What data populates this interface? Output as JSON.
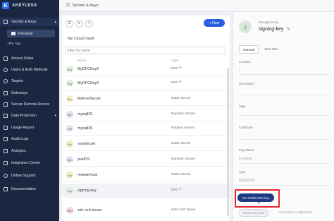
{
  "brand": {
    "logo_letter": "K",
    "name": "AKEYLESS"
  },
  "sidebar": {
    "items": [
      {
        "label": "Secrets & Keys",
        "icon": "key-icon"
      },
      {
        "label": "Access Roles",
        "icon": "roles-icon"
      },
      {
        "label": "Users & Auth Methods",
        "icon": "users-icon"
      },
      {
        "label": "Targets",
        "icon": "target-icon"
      },
      {
        "label": "Gateways",
        "icon": "gateway-icon"
      },
      {
        "label": "Secure Remote Access",
        "icon": "remote-icon"
      },
      {
        "label": "Data Protection",
        "icon": "shield-icon"
      },
      {
        "label": "Usage Report",
        "icon": "report-icon"
      },
      {
        "label": "Audit Logs",
        "icon": "log-icon"
      },
      {
        "label": "Analytics",
        "icon": "analytics-icon"
      },
      {
        "label": "Integration Center",
        "icon": "integration-icon"
      },
      {
        "label": "Online Support",
        "icon": "support-icon"
      },
      {
        "label": "Documentation",
        "icon": "docs-icon"
      }
    ],
    "sub_item": "Personal",
    "pin_tag": "+Pin Tag"
  },
  "topbar": {
    "breadcrumb": "Secrets & Keys"
  },
  "list": {
    "new_label": "New",
    "vault_title": "My Cloud Vault",
    "filter_placeholder": "Filter by name",
    "col_name": "Name",
    "col_type": "Type",
    "rows": [
      {
        "name": "MyDFCKey2",
        "type": "DFC™",
        "avatar_color": "#dfeedd"
      },
      {
        "name": "MyDFCKey2",
        "type": "DFC™",
        "avatar_color": "#dfeedd"
      },
      {
        "name": "MyFirstSecret",
        "type": "Static Secret",
        "avatar_color": "#f1eec2"
      },
      {
        "name": "mysqlDS",
        "type": "Dynamic Secret",
        "avatar_color": "#e8dbf1"
      },
      {
        "name": "mysqlRS",
        "type": "Rotated Secret",
        "avatar_color": "#e8dbf1"
      },
      {
        "name": "newSecret",
        "type": "Static Secret",
        "avatar_color": "#f1eec2"
      },
      {
        "name": "postDS",
        "type": "Dynamic Secret",
        "avatar_color": "#e8dbf1"
      },
      {
        "name": "remote-host",
        "type": "Static Secret",
        "avatar_color": "#f1eec2"
      },
      {
        "name": "signing-key",
        "type": "DFC™",
        "avatar_color": "#dfeedd"
      },
      {
        "name": "ssh-cert-issuer",
        "type": "SSH Cert Issuer",
        "avatar_color": "#f4d5d5"
      }
    ]
  },
  "detail": {
    "kind": "Encryption Key",
    "name": "signing-key",
    "tabs": [
      "General",
      "Item Stat"
    ],
    "fields": [
      {
        "label": "Location",
        "value": "/"
      },
      {
        "label": "Description",
        "value": ""
      },
      {
        "label": "Tags",
        "value": ""
      },
      {
        "label": "Certificate",
        "value": ""
      },
      {
        "label": "Key Status",
        "value": "Enabled"
      },
      {
        "label": "Type",
        "value": "RSA2048"
      }
    ],
    "get_key_btn": "Get Public RSA key",
    "rotate_btn": "Rotate Key Now",
    "rotate_conf": "Auto Rotate Configuration"
  },
  "colors": {
    "sidebar": "#1b2741",
    "accent": "#2c5fe0",
    "highlight": "#e4262a"
  }
}
